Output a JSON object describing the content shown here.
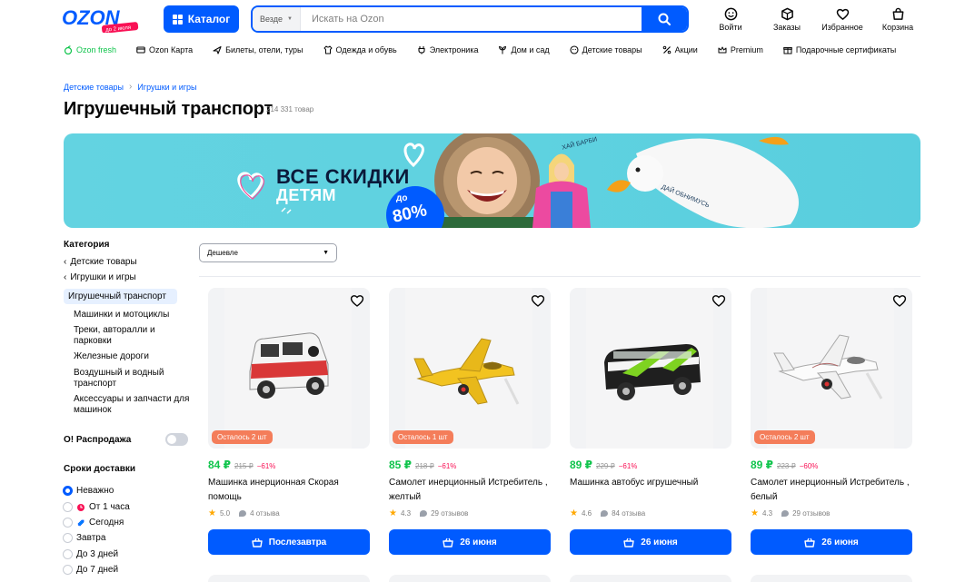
{
  "header": {
    "logo_text": "OZON",
    "logo_sub": "до 2 июля",
    "catalog_label": "Каталог",
    "search_scope": "Везде",
    "search_placeholder": "Искать на Ozon",
    "icons": [
      {
        "name": "login",
        "label": "Войти",
        "icon": "smile-icon"
      },
      {
        "name": "orders",
        "label": "Заказы",
        "icon": "box-icon"
      },
      {
        "name": "favorites",
        "label": "Избранное",
        "icon": "heart-icon"
      },
      {
        "name": "cart",
        "label": "Корзина",
        "icon": "bag-icon"
      }
    ]
  },
  "nav": {
    "items": [
      {
        "label": "Ozon fresh",
        "icon": "apple-icon"
      },
      {
        "label": "Ozon Карта",
        "icon": "card-icon"
      },
      {
        "label": "Билеты, отели, туры",
        "icon": "plane-icon"
      },
      {
        "label": "Одежда и обувь",
        "icon": "shirt-icon"
      },
      {
        "label": "Электроника",
        "icon": "plug-icon"
      },
      {
        "label": "Дом и сад",
        "icon": "plant-icon"
      },
      {
        "label": "Детские товары",
        "icon": "baby-icon"
      },
      {
        "label": "Акции",
        "icon": "percent-icon"
      },
      {
        "label": "Premium",
        "icon": "crown-icon"
      },
      {
        "label": "Подарочные сертификаты",
        "icon": "gift-icon"
      }
    ]
  },
  "breadcrumb": [
    "Детские товары",
    "Игрушки и игры"
  ],
  "page": {
    "title": "Игрушечный транспорт",
    "count": "214 331 товар"
  },
  "banner": {
    "line1": "ВСЕ СКИДКИ",
    "line2": "ДЕТЯМ",
    "prefix": "до",
    "percent": "80%",
    "note1": "ХАЙ БАРБИ",
    "note2": "ДАЙ ОБНИМУСЬ",
    "colors": {
      "bg": "#5fd2e0",
      "accent": "#005bff"
    }
  },
  "sidebar": {
    "category_heading": "Категория",
    "back_items": [
      "Детские товары",
      "Игрушки и игры"
    ],
    "active": "Игрушечный транспорт",
    "subs": [
      "Машинки и мотоциклы",
      "Треки, авторалли и парковки",
      "Железные дороги",
      "Воздушный и водный транспорт",
      "Аксессуары и запчасти для машинок"
    ],
    "sale_label": "О! Распродажа",
    "sale_enabled": false,
    "delivery_heading": "Сроки доставки",
    "delivery_options": [
      {
        "label": "Неважно",
        "selected": true
      },
      {
        "label": "От 1 часа",
        "selected": false
      },
      {
        "label": "Сегодня",
        "selected": false
      },
      {
        "label": "Завтра",
        "selected": false
      },
      {
        "label": "До 3 дней",
        "selected": false
      },
      {
        "label": "До 7 дней",
        "selected": false
      }
    ]
  },
  "sort": {
    "value": "Дешевле"
  },
  "products": [
    {
      "stock": "Осталось 2 шт",
      "price": "84 ₽",
      "old_price": "215 ₽",
      "discount": "−61%",
      "name": "Машинка инерционная Скорая помощь",
      "rating": "5.0",
      "reviews": "4 отзыва",
      "delivery": "Послезавтра",
      "image": "ambulance-toy"
    },
    {
      "stock": "Осталось 1 шт",
      "price": "85 ₽",
      "old_price": "218 ₽",
      "discount": "−61%",
      "name": "Самолет инерционный Истребитель , желтый",
      "rating": "4.3",
      "reviews": "29 отзывов",
      "delivery": "26 июня",
      "image": "yellow-jet-toy"
    },
    {
      "stock": "",
      "price": "89 ₽",
      "old_price": "229 ₽",
      "discount": "−61%",
      "name": "Машинка автобус игрушечный",
      "rating": "4.6",
      "reviews": "84 отзыва",
      "delivery": "26 июня",
      "image": "school-bus-toy"
    },
    {
      "stock": "Осталось 2 шт",
      "price": "89 ₽",
      "old_price": "223 ₽",
      "discount": "−60%",
      "name": "Самолет инерционный Истребитель , белый",
      "rating": "4.3",
      "reviews": "29 отзывов",
      "delivery": "26 июня",
      "image": "white-jet-toy"
    }
  ],
  "colors": {
    "brand": "#005bff",
    "price": "#10c44c",
    "discount": "#f91155",
    "stock_badge": "#f47d5a"
  }
}
